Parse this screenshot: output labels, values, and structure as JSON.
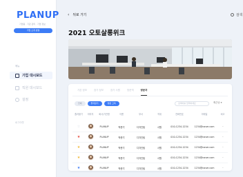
{
  "brand": {
    "logo": "PLANUP",
    "subtitle": "기업용 · 기관 관리 · 기업 정보",
    "sub_button": "기업 소개 변경"
  },
  "sidebar": {
    "section_label": "메뉴",
    "items": [
      {
        "label": "기업 대시보드",
        "icon": "dashboard-icon",
        "active": true
      },
      {
        "label": "직원 대시보드",
        "icon": "users-icon",
        "active": false
      },
      {
        "label": "설정",
        "icon": "gear-icon",
        "active": false
      }
    ],
    "footer": "로그아웃"
  },
  "topbar": {
    "back_label": "뒤로 가기",
    "search_label": "검색"
  },
  "page_title": "2021 오토살롱위크",
  "tabs": [
    "기본 정보",
    "참가 정보",
    "참가 사원",
    "방문객",
    "방문자"
  ],
  "active_tab_index": 4,
  "chips": [
    {
      "label": "전체",
      "active": false
    },
    {
      "label": "즐겨찾기",
      "active": true
    },
    {
      "label": "방문 고객",
      "active": true
    }
  ],
  "filter": {
    "placeholder": "검색어를 입력하세요",
    "select_value": "최근순 ▾"
  },
  "table": {
    "headers": [
      "즐겨찾기",
      "이미지",
      "회사/기관명",
      "이름",
      "부서",
      "직위",
      "전화번호",
      "이메일",
      "비고"
    ],
    "rows": [
      {
        "starred": false,
        "company": "PLANUP",
        "name": "박준기",
        "dept": "디자인팀",
        "title": "사원",
        "phone": "010-1234-1234",
        "email": "1234@naver.com",
        "note": "···"
      },
      {
        "starred": true,
        "star_color": "#e64a3c",
        "company": "PLANUP",
        "name": "박준기",
        "dept": "디자인팀",
        "title": "사원",
        "phone": "010-1234-1234",
        "email": "1234@naver.com",
        "note": "···"
      },
      {
        "starred": true,
        "star_color": "#f2b93b",
        "company": "PLANUP",
        "name": "박준기",
        "dept": "디자인팀",
        "title": "사원",
        "phone": "010-1234-1234",
        "email": "1234@naver.com",
        "note": "···"
      },
      {
        "starred": true,
        "star_color": "#f2b93b",
        "company": "PLANUP",
        "name": "박준기",
        "dept": "디자인팀",
        "title": "사원",
        "phone": "010-1234-1234",
        "email": "1234@naver.com",
        "note": "···"
      },
      {
        "starred": true,
        "star_color": "#3d7cf6",
        "company": "PLANUP",
        "name": "박준기",
        "dept": "디자인팀",
        "title": "사원",
        "phone": "010-1234-1234",
        "email": "1234@naver.com",
        "note": "···"
      }
    ]
  },
  "colors": {
    "accent": "#3d7cf6",
    "logo": "#2f6ff5",
    "background": "#eef2f8"
  }
}
